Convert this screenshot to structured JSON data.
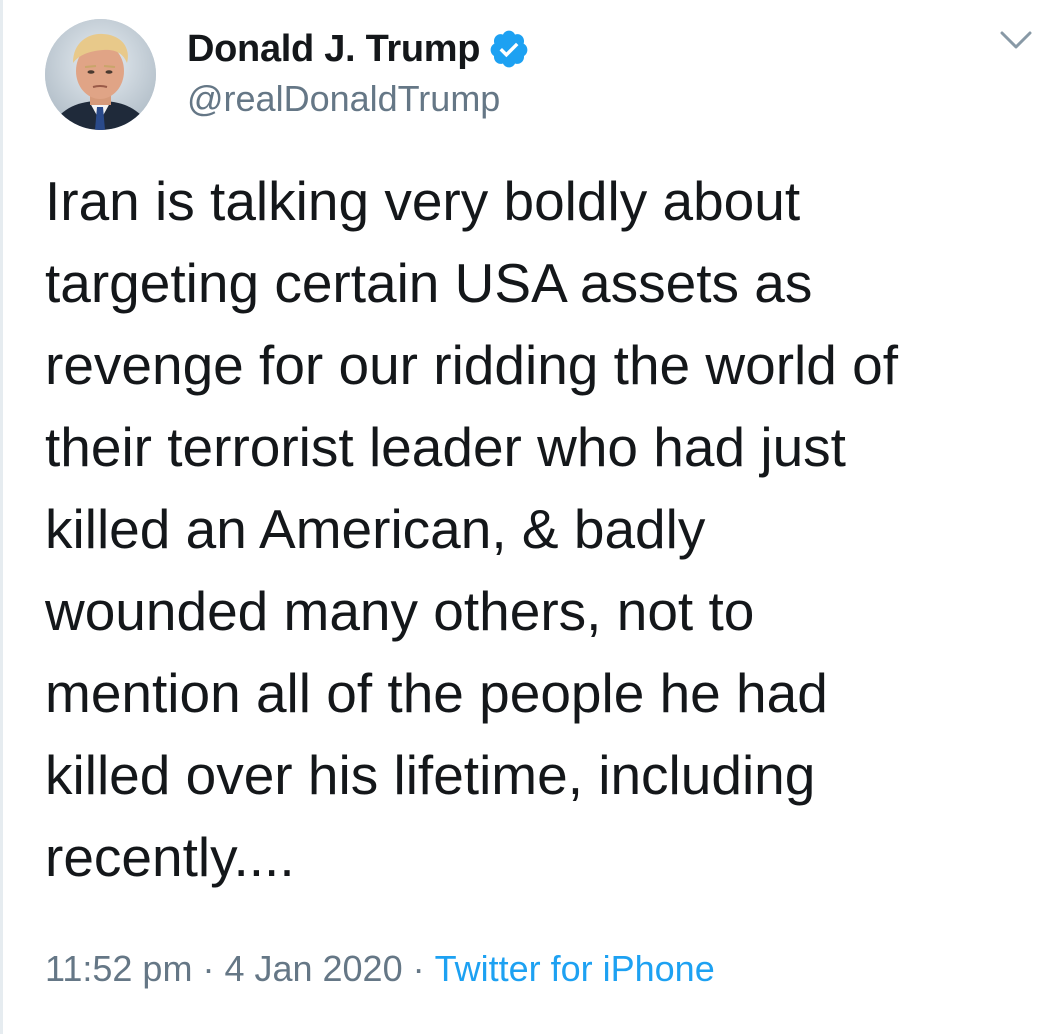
{
  "author": {
    "display_name": "Donald J. Trump",
    "handle": "@realDonaldTrump",
    "verified": true,
    "avatar_icon": "profile-photo"
  },
  "tweet": {
    "lines": [
      "Iran is talking very boldly about",
      "targeting certain USA assets as",
      "revenge for our ridding the world of",
      "their terrorist leader who had just",
      "killed an American, & badly",
      "wounded many others, not to",
      "mention all of the people he had",
      "killed over his lifetime, including",
      "recently...."
    ]
  },
  "meta": {
    "time": "11:52 pm",
    "separator": "·",
    "date": "4 Jan 2020",
    "source": "Twitter for iPhone"
  },
  "icons": {
    "verified": "verified-badge-icon",
    "caret": "chevron-down-icon"
  },
  "colors": {
    "text": "#14171a",
    "secondary": "#657786",
    "accent": "#1da1f2"
  }
}
